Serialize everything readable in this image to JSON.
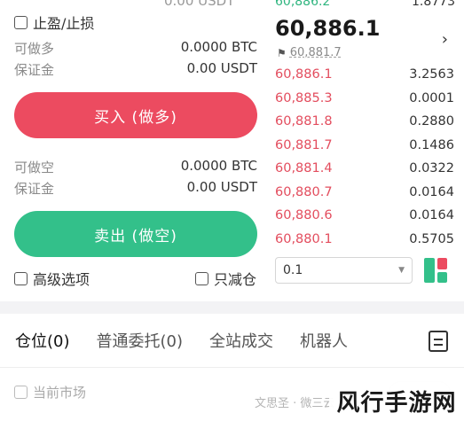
{
  "left": {
    "top_cut": "0.00 USDT",
    "tp_sl_label": "止盈/止损",
    "buy_block": [
      {
        "label": "可做多",
        "value": "0.0000 BTC"
      },
      {
        "label": "保证金",
        "value": "0.00 USDT"
      }
    ],
    "buy_button": "买入 (做多)",
    "sell_block": [
      {
        "label": "可做空",
        "value": "0.0000 BTC"
      },
      {
        "label": "保证金",
        "value": "0.00 USDT"
      }
    ],
    "sell_button": "卖出 (做空)",
    "advanced_label": "高级选项",
    "reduce_only_label": "只减仓"
  },
  "book": {
    "top_ask": {
      "price": "60,886.2",
      "qty": "1.8773"
    },
    "last_price": "60,886.1",
    "mark_price": "60,881.7",
    "bids": [
      {
        "price": "60,886.1",
        "qty": "3.2563",
        "depth": 0.55
      },
      {
        "price": "60,885.3",
        "qty": "0.0001",
        "depth": 0.02
      },
      {
        "price": "60,881.8",
        "qty": "0.2880",
        "depth": 0.08
      },
      {
        "price": "60,881.7",
        "qty": "0.1486",
        "depth": 0.05
      },
      {
        "price": "60,881.4",
        "qty": "0.0322",
        "depth": 0.03
      },
      {
        "price": "60,880.7",
        "qty": "0.0164",
        "depth": 0.02
      },
      {
        "price": "60,880.6",
        "qty": "0.0164",
        "depth": 0.02
      },
      {
        "price": "60,880.1",
        "qty": "0.5705",
        "depth": 0.12
      }
    ],
    "depth_value": "0.1"
  },
  "tabs": [
    {
      "label": "仓位(0)"
    },
    {
      "label": "普通委托(0)"
    },
    {
      "label": "全站成交"
    },
    {
      "label": "机器人"
    }
  ],
  "bottom": {
    "current_market_label": "当前市场"
  },
  "watermark": {
    "text": "文思圣 · 微三云",
    "logo": "风行手游网"
  },
  "colors": {
    "buy": "#ec4b60",
    "sell": "#33c08a",
    "ask_price": "#2fb57f",
    "bid_price": "#e34d5e"
  }
}
